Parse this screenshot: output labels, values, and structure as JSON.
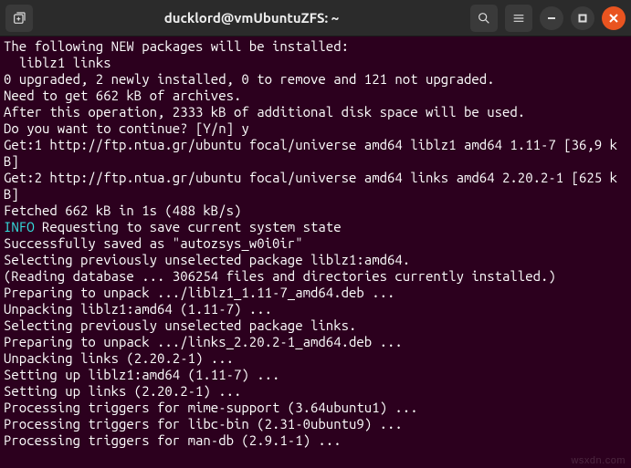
{
  "titlebar": {
    "title": "ducklord@vmUbuntuZFS: ~"
  },
  "terminal": {
    "lines": [
      {
        "text": "The following NEW packages will be installed:"
      },
      {
        "text": "  liblz1 links"
      },
      {
        "text": "0 upgraded, 2 newly installed, 0 to remove and 121 not upgraded."
      },
      {
        "text": "Need to get 662 kB of archives."
      },
      {
        "text": "After this operation, 2333 kB of additional disk space will be used."
      },
      {
        "text": "Do you want to continue? [Y/n] y"
      },
      {
        "text": "Get:1 http://ftp.ntua.gr/ubuntu focal/universe amd64 liblz1 amd64 1.11-7 [36,9 kB]"
      },
      {
        "text": "Get:2 http://ftp.ntua.gr/ubuntu focal/universe amd64 links amd64 2.20.2-1 [625 kB]"
      },
      {
        "text": "Fetched 662 kB in 1s (488 kB/s)"
      },
      {
        "prefix": "INFO",
        "prefix_class": "info",
        "text": " Requesting to save current system state"
      },
      {
        "text": "Successfully saved as \"autozsys_w0i0ir\""
      },
      {
        "text": "Selecting previously unselected package liblz1:amd64."
      },
      {
        "text": "(Reading database ... 306254 files and directories currently installed.)"
      },
      {
        "text": "Preparing to unpack .../liblz1_1.11-7_amd64.deb ..."
      },
      {
        "text": "Unpacking liblz1:amd64 (1.11-7) ..."
      },
      {
        "text": "Selecting previously unselected package links."
      },
      {
        "text": "Preparing to unpack .../links_2.20.2-1_amd64.deb ..."
      },
      {
        "text": "Unpacking links (2.20.2-1) ..."
      },
      {
        "text": "Setting up liblz1:amd64 (1.11-7) ..."
      },
      {
        "text": "Setting up links (2.20.2-1) ..."
      },
      {
        "text": "Processing triggers for mime-support (3.64ubuntu1) ..."
      },
      {
        "text": "Processing triggers for libc-bin (2.31-0ubuntu9) ..."
      },
      {
        "text": "Processing triggers for man-db (2.9.1-1) ..."
      }
    ]
  },
  "watermark": "wsxdn.com"
}
